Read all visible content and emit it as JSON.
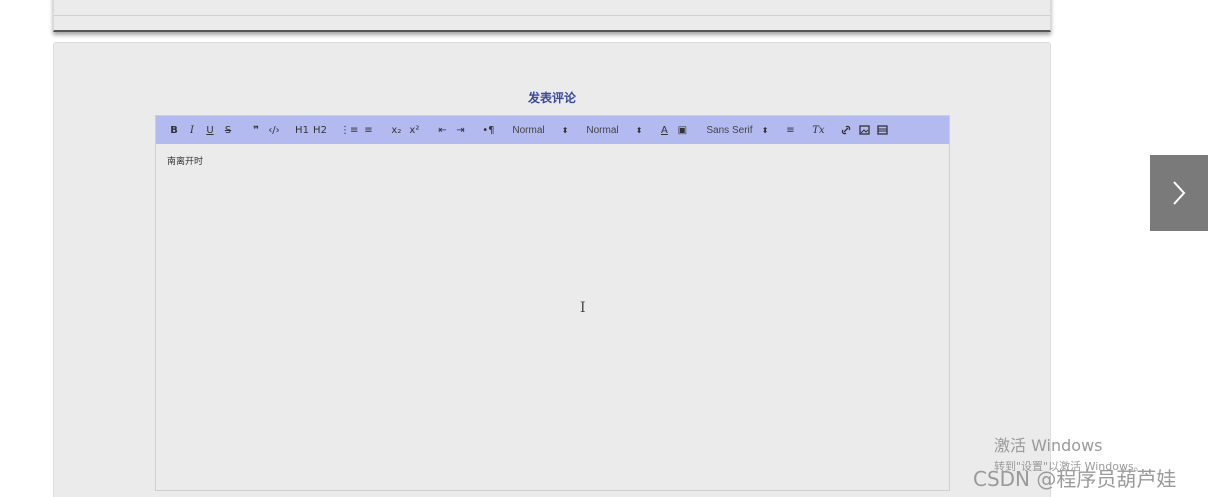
{
  "comment_section": {
    "title": "发表评论"
  },
  "toolbar": {
    "bold": "B",
    "italic": "I",
    "underline": "U",
    "strike": "S",
    "blockquote": "❞",
    "code": "‹/›",
    "h1": "H1",
    "h2": "H2",
    "ordered_list": "⋮≡",
    "bullet_list": "≡",
    "subscript": "x₂",
    "superscript": "x²",
    "outdent": "⇤",
    "indent": "⇥",
    "direction": "•¶",
    "size_select": "Normal",
    "header_select": "Normal",
    "font_color": "A",
    "background_color": "▣",
    "font_select": "Sans Serif",
    "align": "≡",
    "clean": "Tx",
    "link": "🔗",
    "image": "▭",
    "video": "▤",
    "select_arrow": "⬍"
  },
  "editor": {
    "content": "南离开时"
  },
  "navigation": {
    "next_arrow": "›"
  },
  "watermark": {
    "activate_title": "激活 Windows",
    "activate_sub": "转到\"设置\"以激活 Windows。",
    "csdn": "CSDN @程序员葫芦娃"
  },
  "colors": {
    "toolbar_bg": "#b3baf0",
    "title_color": "#3c4a9e",
    "card_bg": "#ebebeb"
  }
}
